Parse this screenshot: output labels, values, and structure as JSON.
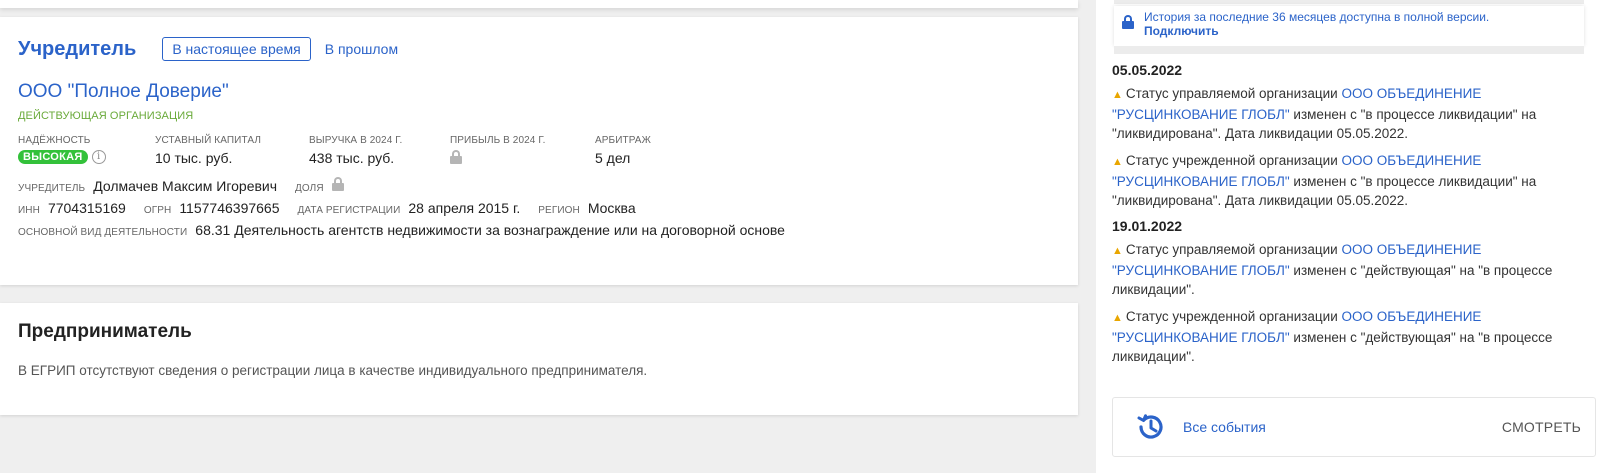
{
  "founder": {
    "title": "Учредитель",
    "tab_present": "В настоящее время",
    "tab_past": "В прошлом",
    "org_name": "ООО \"Полное Доверие\"",
    "org_status": "ДЕЙСТВУЮЩАЯ ОРГАНИЗАЦИЯ",
    "metrics": {
      "reliability_label": "НАДЁЖНОСТЬ",
      "reliability_value": "ВЫСОКАЯ",
      "capital_label": "УСТАВНЫЙ КАПИТАЛ",
      "capital_value": "10 тыс. руб.",
      "revenue_label": "ВЫРУЧКА В 2024 Г.",
      "revenue_value": "438 тыс. руб.",
      "profit_label": "ПРИБЫЛЬ В 2024 Г.",
      "arbitration_label": "АРБИТРАЖ",
      "arbitration_value": "5 дел"
    },
    "founder_label": "УЧРЕДИТЕЛЬ",
    "founder_name": "Долмачев Максим Игоревич",
    "share_label": "ДОЛЯ",
    "inn_label": "ИНН",
    "inn_value": "7704315169",
    "ogrn_label": "ОГРН",
    "ogrn_value": "1157746397665",
    "reg_date_label": "ДАТА РЕГИСТРАЦИИ",
    "reg_date_value": "28 апреля 2015 г.",
    "region_label": "РЕГИОН",
    "region_value": "Москва",
    "activity_label": "ОСНОВНОЙ ВИД ДЕЯТЕЛЬНОСТИ",
    "activity_value": "68.31 Деятельность агентств недвижимости за вознаграждение или на договорной основе"
  },
  "entrepreneur": {
    "title": "Предприниматель",
    "text": "В ЕГРИП отсутствуют сведения о регистрации лица в качестве индивидуального предпринимателя."
  },
  "notice": {
    "text": "История за последние 36 месяцев доступна в полной версии.",
    "link": "Подключить"
  },
  "events": [
    {
      "date": "05.05.2022",
      "items": [
        {
          "prefix": "Статус управляемой организации ",
          "link": "ООО ОБЪЕДИНЕНИЕ \"РУСЦИНКОВАНИЕ ГЛОБЛ\"",
          "suffix": " изменен с \"в процессе ликвидации\" на \"ликвидирована\". Дата ликвидации 05.05.2022."
        },
        {
          "prefix": "Статус учрежденной организации ",
          "link": "ООО ОБЪЕДИНЕНИЕ \"РУСЦИНКОВАНИЕ ГЛОБЛ\"",
          "suffix": " изменен с \"в процессе ликвидации\" на \"ликвидирована\". Дата ликвидации 05.05.2022."
        }
      ]
    },
    {
      "date": "19.01.2022",
      "items": [
        {
          "prefix": "Статус управляемой организации ",
          "link": "ООО ОБЪЕДИНЕНИЕ \"РУСЦИНКОВАНИЕ ГЛОБЛ\"",
          "suffix": " изменен с \"действующая\" на \"в процессе ликвидации\"."
        },
        {
          "prefix": "Статус учрежденной организации ",
          "link": "ООО ОБЪЕДИНЕНИЕ \"РУСЦИНКОВАНИЕ ГЛОБЛ\"",
          "suffix": " изменен с \"действующая\" на \"в процессе ликвидации\"."
        }
      ]
    }
  ],
  "all_events": {
    "label": "Все события",
    "button": "СМОТРЕТЬ",
    "icon": "history-icon"
  },
  "colors": {
    "accent": "#2b63c9",
    "badge_green": "#33c13a",
    "status_green": "#6aaa3a",
    "warning": "#e9a600"
  }
}
